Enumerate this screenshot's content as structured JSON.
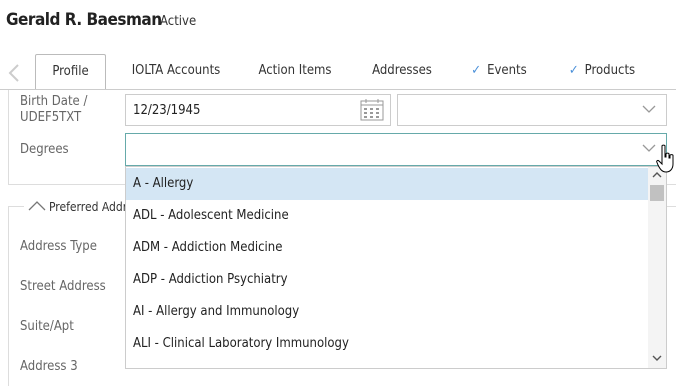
{
  "header": {
    "name": "Gerald R. Baesman",
    "status": "Active"
  },
  "tabs": [
    {
      "label": "Profile",
      "active": true,
      "checked": false
    },
    {
      "label": "IOLTA Accounts",
      "active": false,
      "checked": false
    },
    {
      "label": "Action Items",
      "active": false,
      "checked": false
    },
    {
      "label": "Addresses",
      "active": false,
      "checked": false
    },
    {
      "label": "Events",
      "active": false,
      "checked": true
    },
    {
      "label": "Products",
      "active": false,
      "checked": true
    }
  ],
  "form": {
    "birth_date_label_line1": "Birth Date /",
    "birth_date_label_line2": "UDEF5TXT",
    "birth_date_value": "12/23/1945",
    "degrees_label": "Degrees",
    "degrees_value": ""
  },
  "preferred_address": {
    "title": "Preferred Address",
    "labels": [
      "Address Type",
      "Street Address",
      "Suite/Apt",
      "Address 3"
    ]
  },
  "degrees_options": [
    "A - Allergy",
    "ADL - Adolescent Medicine",
    "ADM - Addiction Medicine",
    "ADP - Addiction Psychiatry",
    "AI - Allergy and Immunology",
    "ALI - Clinical Laboratory Immunology"
  ],
  "icons": {
    "back": "chevron-left-icon",
    "calendar": "calendar-icon",
    "dropdown": "chevron-down-icon",
    "collapse": "chevron-up-icon",
    "check": "check-icon",
    "cursor": "hand-cursor-icon"
  },
  "colors": {
    "selected_option": "#d4e6f4",
    "check": "#4a90d9",
    "focus_border": "#66aaaa"
  }
}
